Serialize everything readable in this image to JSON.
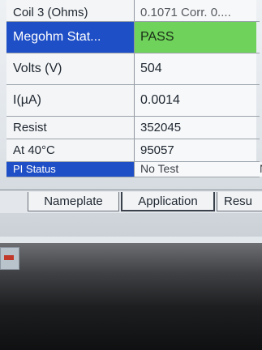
{
  "grid": {
    "rows": [
      {
        "label": "Coil 3 (Ohms)",
        "value": "0.1071 Corr. 0...."
      },
      {
        "label": "Megohm Stat...",
        "value": "PASS"
      },
      {
        "label": "Volts (V)",
        "value": "504"
      },
      {
        "label": "I(µA)",
        "value": "0.0014"
      },
      {
        "label": "Resist",
        "value": "352045"
      },
      {
        "label": "At 40°C",
        "value": "95057"
      },
      {
        "label": "PI Status",
        "value": "No Test",
        "extra": "N"
      }
    ]
  },
  "tabs": [
    {
      "label": "Nameplate"
    },
    {
      "label": "Application"
    },
    {
      "label": "Resu"
    }
  ],
  "colors": {
    "selected": "#1f4fc6",
    "pass": "#6fd25a"
  }
}
